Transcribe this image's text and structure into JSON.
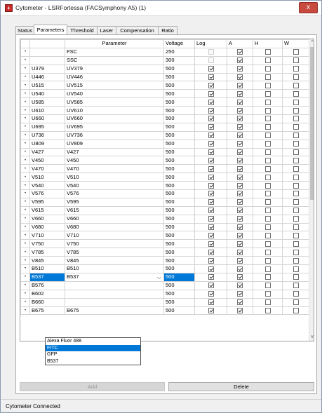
{
  "window": {
    "title": "Cytometer - LSRFortessa (FACSymphony A5) (1)",
    "close_glyph": "x",
    "app_icon": "cytometer-app-icon"
  },
  "tabs": [
    {
      "label": "Status",
      "active": false
    },
    {
      "label": "Parameters",
      "active": true
    },
    {
      "label": "Threshold",
      "active": false
    },
    {
      "label": "Laser",
      "active": false
    },
    {
      "label": "Compensation",
      "active": false
    },
    {
      "label": "Ratio",
      "active": false
    }
  ],
  "grid": {
    "columns": [
      "",
      "",
      "Parameter",
      "Voltage",
      "Log",
      "A",
      "H",
      "W"
    ],
    "row_marker": "•",
    "rows": [
      {
        "name": "",
        "parameter": "FSC",
        "voltage": "250",
        "log": false,
        "log_enabled": false,
        "a": true,
        "h": false,
        "w": false
      },
      {
        "name": "",
        "parameter": "SSC",
        "voltage": "300",
        "log": false,
        "log_enabled": false,
        "a": true,
        "h": false,
        "w": false
      },
      {
        "name": "U379",
        "parameter": "UV379",
        "voltage": "500",
        "log": true,
        "log_enabled": true,
        "a": true,
        "h": false,
        "w": false
      },
      {
        "name": "U446",
        "parameter": "UV446",
        "voltage": "500",
        "log": true,
        "log_enabled": true,
        "a": true,
        "h": false,
        "w": false
      },
      {
        "name": "U515",
        "parameter": "UV515",
        "voltage": "500",
        "log": true,
        "log_enabled": true,
        "a": true,
        "h": false,
        "w": false
      },
      {
        "name": "U540",
        "parameter": "UV540",
        "voltage": "500",
        "log": true,
        "log_enabled": true,
        "a": true,
        "h": false,
        "w": false
      },
      {
        "name": "U585",
        "parameter": "UV585",
        "voltage": "500",
        "log": true,
        "log_enabled": true,
        "a": true,
        "h": false,
        "w": false
      },
      {
        "name": "U610",
        "parameter": "UV610",
        "voltage": "500",
        "log": true,
        "log_enabled": true,
        "a": true,
        "h": false,
        "w": false
      },
      {
        "name": "U660",
        "parameter": "UV660",
        "voltage": "500",
        "log": true,
        "log_enabled": true,
        "a": true,
        "h": false,
        "w": false
      },
      {
        "name": "U695",
        "parameter": "UV695",
        "voltage": "500",
        "log": true,
        "log_enabled": true,
        "a": true,
        "h": false,
        "w": false
      },
      {
        "name": "U736",
        "parameter": "UV736",
        "voltage": "500",
        "log": true,
        "log_enabled": true,
        "a": true,
        "h": false,
        "w": false
      },
      {
        "name": "U809",
        "parameter": "UV809",
        "voltage": "500",
        "log": true,
        "log_enabled": true,
        "a": true,
        "h": false,
        "w": false
      },
      {
        "name": "V427",
        "parameter": "V427",
        "voltage": "500",
        "log": true,
        "log_enabled": true,
        "a": true,
        "h": false,
        "w": false
      },
      {
        "name": "V450",
        "parameter": "V450",
        "voltage": "500",
        "log": true,
        "log_enabled": true,
        "a": true,
        "h": false,
        "w": false
      },
      {
        "name": "V470",
        "parameter": "V470",
        "voltage": "500",
        "log": true,
        "log_enabled": true,
        "a": true,
        "h": false,
        "w": false
      },
      {
        "name": "V510",
        "parameter": "V510",
        "voltage": "500",
        "log": true,
        "log_enabled": true,
        "a": true,
        "h": false,
        "w": false
      },
      {
        "name": "V540",
        "parameter": "V540",
        "voltage": "500",
        "log": true,
        "log_enabled": true,
        "a": true,
        "h": false,
        "w": false
      },
      {
        "name": "V576",
        "parameter": "V576",
        "voltage": "500",
        "log": true,
        "log_enabled": true,
        "a": true,
        "h": false,
        "w": false
      },
      {
        "name": "V595",
        "parameter": "V595",
        "voltage": "500",
        "log": true,
        "log_enabled": true,
        "a": true,
        "h": false,
        "w": false
      },
      {
        "name": "V615",
        "parameter": "V615",
        "voltage": "500",
        "log": true,
        "log_enabled": true,
        "a": true,
        "h": false,
        "w": false
      },
      {
        "name": "V660",
        "parameter": "V660",
        "voltage": "500",
        "log": true,
        "log_enabled": true,
        "a": true,
        "h": false,
        "w": false
      },
      {
        "name": "V680",
        "parameter": "V680",
        "voltage": "500",
        "log": true,
        "log_enabled": true,
        "a": true,
        "h": false,
        "w": false
      },
      {
        "name": "V710",
        "parameter": "V710",
        "voltage": "500",
        "log": true,
        "log_enabled": true,
        "a": true,
        "h": false,
        "w": false
      },
      {
        "name": "V750",
        "parameter": "V750",
        "voltage": "500",
        "log": true,
        "log_enabled": true,
        "a": true,
        "h": false,
        "w": false
      },
      {
        "name": "V785",
        "parameter": "V785",
        "voltage": "500",
        "log": true,
        "log_enabled": true,
        "a": true,
        "h": false,
        "w": false
      },
      {
        "name": "V845",
        "parameter": "V845",
        "voltage": "500",
        "log": true,
        "log_enabled": true,
        "a": true,
        "h": false,
        "w": false
      },
      {
        "name": "B510",
        "parameter": "B510",
        "voltage": "500",
        "log": true,
        "log_enabled": true,
        "a": true,
        "h": false,
        "w": false
      },
      {
        "name": "B537",
        "parameter": "B537",
        "voltage": "500",
        "log": true,
        "log_enabled": true,
        "a": true,
        "h": false,
        "w": false,
        "selected": true,
        "editing": true
      },
      {
        "name": "B576",
        "parameter": "",
        "voltage": "500",
        "log": true,
        "log_enabled": true,
        "a": true,
        "h": false,
        "w": false
      },
      {
        "name": "B602",
        "parameter": "",
        "voltage": "500",
        "log": true,
        "log_enabled": true,
        "a": true,
        "h": false,
        "w": false
      },
      {
        "name": "B660",
        "parameter": "",
        "voltage": "500",
        "log": true,
        "log_enabled": true,
        "a": true,
        "h": false,
        "w": false
      },
      {
        "name": "B675",
        "parameter": "B675",
        "voltage": "500",
        "log": true,
        "log_enabled": true,
        "a": true,
        "h": false,
        "w": false
      }
    ]
  },
  "dropdown": {
    "options": [
      "Alexa Fluor 488",
      "FITC",
      "GFP",
      "B537"
    ],
    "highlighted": "FITC",
    "arrow_glyph": "⌵"
  },
  "scrollbar": {
    "up_glyph": "^",
    "down_glyph": "v"
  },
  "buttons": {
    "add_label": "Add",
    "add_enabled": false,
    "delete_label": "Delete"
  },
  "status": {
    "text": "Cytometer Connected"
  },
  "colors": {
    "selection": "#0078d7",
    "close_button": "#c94a3f"
  }
}
